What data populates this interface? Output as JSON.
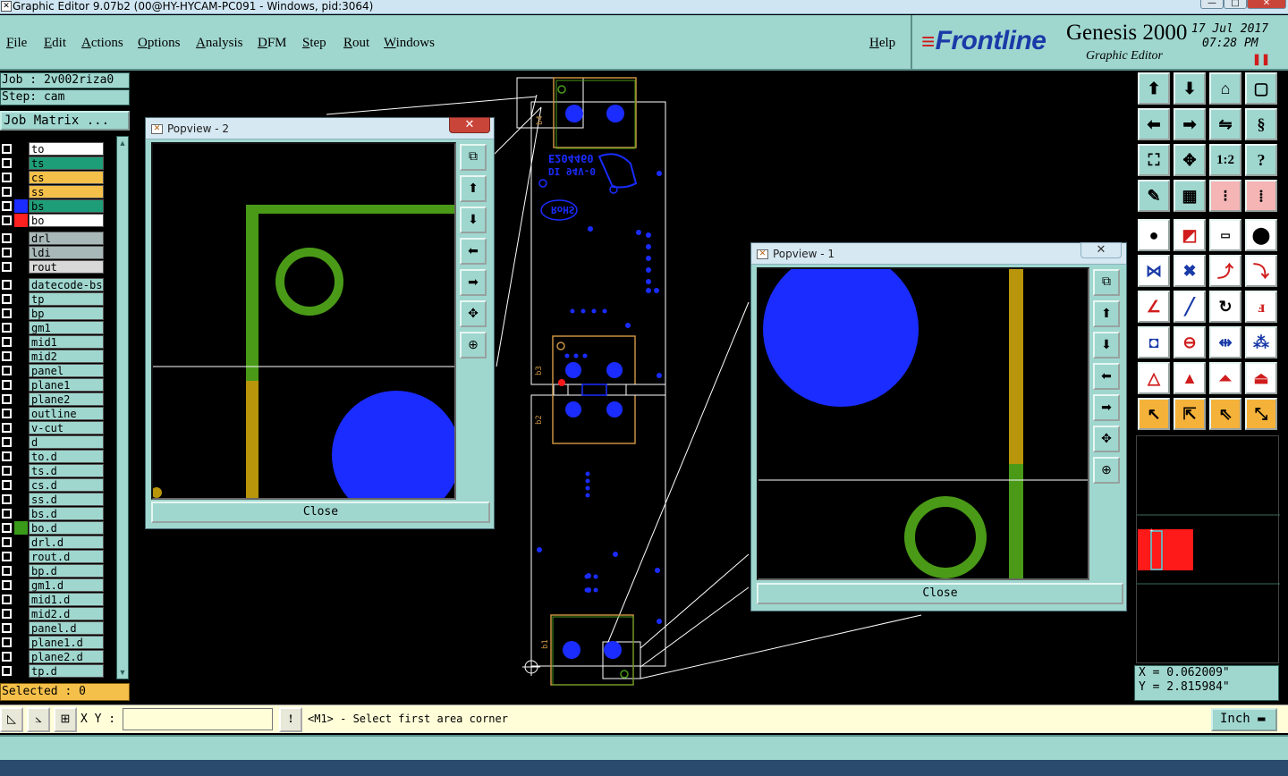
{
  "window": {
    "title": "Graphic Editor 9.07b2 (00@HY-HYCAM-PC091 - Windows, pid:3064)",
    "minimize": "—",
    "maximize": "□",
    "close": "✕"
  },
  "menu": {
    "items": [
      "File",
      "Edit",
      "Actions",
      "Options",
      "Analysis",
      "DFM",
      "Step",
      "Rout",
      "Windows"
    ],
    "help": "Help"
  },
  "brand": {
    "logo": "Frontline",
    "product": "Genesis 2000",
    "subtitle": "Graphic Editor",
    "date": "17 Jul 2017",
    "time": "07:28 PM"
  },
  "job": {
    "job_line": "Job : 2v002riza0",
    "step_line": "Step: cam",
    "matrix_button": "Job Matrix ...",
    "selected": "Selected : 0"
  },
  "layers": [
    {
      "name": "to",
      "bg": "#ffffff",
      "swatch": ""
    },
    {
      "name": "ts",
      "bg": "#1e9e78",
      "swatch": ""
    },
    {
      "name": "cs",
      "bg": "#f5c04a",
      "swatch": ""
    },
    {
      "name": "ss",
      "bg": "#f5c04a",
      "swatch": ""
    },
    {
      "name": "bs",
      "bg": "#1e9e78",
      "swatch": "#1a2cff"
    },
    {
      "name": "bo",
      "bg": "#ffffff",
      "swatch": "#ff2020"
    },
    {
      "name": "drl",
      "bg": "#a8b8b8",
      "swatch": ""
    },
    {
      "name": "ldi",
      "bg": "#a8b8b8",
      "swatch": ""
    },
    {
      "name": "rout",
      "bg": "#d8d8d8",
      "swatch": ""
    },
    {
      "name": "datecode-bs",
      "bg": "#9fd7cf",
      "swatch": ""
    },
    {
      "name": "tp",
      "bg": "#9fd7cf",
      "swatch": ""
    },
    {
      "name": "bp",
      "bg": "#9fd7cf",
      "swatch": ""
    },
    {
      "name": "gm1",
      "bg": "#9fd7cf",
      "swatch": ""
    },
    {
      "name": "mid1",
      "bg": "#9fd7cf",
      "swatch": ""
    },
    {
      "name": "mid2",
      "bg": "#9fd7cf",
      "swatch": ""
    },
    {
      "name": "panel",
      "bg": "#9fd7cf",
      "swatch": ""
    },
    {
      "name": "plane1",
      "bg": "#9fd7cf",
      "swatch": ""
    },
    {
      "name": "plane2",
      "bg": "#9fd7cf",
      "swatch": ""
    },
    {
      "name": "outline",
      "bg": "#9fd7cf",
      "swatch": ""
    },
    {
      "name": "v-cut",
      "bg": "#9fd7cf",
      "swatch": ""
    },
    {
      "name": "d",
      "bg": "#9fd7cf",
      "swatch": ""
    },
    {
      "name": "to.d",
      "bg": "#9fd7cf",
      "swatch": ""
    },
    {
      "name": "ts.d",
      "bg": "#9fd7cf",
      "swatch": ""
    },
    {
      "name": "cs.d",
      "bg": "#9fd7cf",
      "swatch": ""
    },
    {
      "name": "ss.d",
      "bg": "#9fd7cf",
      "swatch": ""
    },
    {
      "name": "bs.d",
      "bg": "#9fd7cf",
      "swatch": ""
    },
    {
      "name": "bo.d",
      "bg": "#9fd7cf",
      "swatch": "#3a9a1a"
    },
    {
      "name": "drl.d",
      "bg": "#9fd7cf",
      "swatch": ""
    },
    {
      "name": "rout.d",
      "bg": "#9fd7cf",
      "swatch": ""
    },
    {
      "name": "bp.d",
      "bg": "#9fd7cf",
      "swatch": ""
    },
    {
      "name": "gm1.d",
      "bg": "#9fd7cf",
      "swatch": ""
    },
    {
      "name": "mid1.d",
      "bg": "#9fd7cf",
      "swatch": ""
    },
    {
      "name": "mid2.d",
      "bg": "#9fd7cf",
      "swatch": ""
    },
    {
      "name": "panel.d",
      "bg": "#9fd7cf",
      "swatch": ""
    },
    {
      "name": "plane1.d",
      "bg": "#9fd7cf",
      "swatch": ""
    },
    {
      "name": "plane2.d",
      "bg": "#9fd7cf",
      "swatch": ""
    },
    {
      "name": "tp.d",
      "bg": "#9fd7cf",
      "swatch": ""
    }
  ],
  "board": {
    "text_lines": [
      "E204460",
      "DI 94V-0",
      "RoHS"
    ],
    "labels": [
      "b4",
      "b3",
      "b2",
      "b1"
    ]
  },
  "popview2": {
    "title": "Popview - 2",
    "close_label": "Close",
    "close_x": "✕"
  },
  "popview1": {
    "title": "Popview - 1",
    "close_label": "Close",
    "close_x": "✕"
  },
  "cmd": {
    "xy_label": "X Y :",
    "xy_value": "",
    "alert": "!",
    "prompt": "<M1> - Select first area corner",
    "unit": "Inch"
  },
  "coords": {
    "x": "X = 0.062009\"",
    "y": "Y = 2.815984\""
  },
  "colors": {
    "panel_teal": "#9fd7cf",
    "pad_blue": "#1a2cff",
    "trace_green": "#4a9a18",
    "trace_gold": "#b8950a",
    "outline_orange": "#c89040",
    "highlight_red": "#ff1a1a"
  }
}
